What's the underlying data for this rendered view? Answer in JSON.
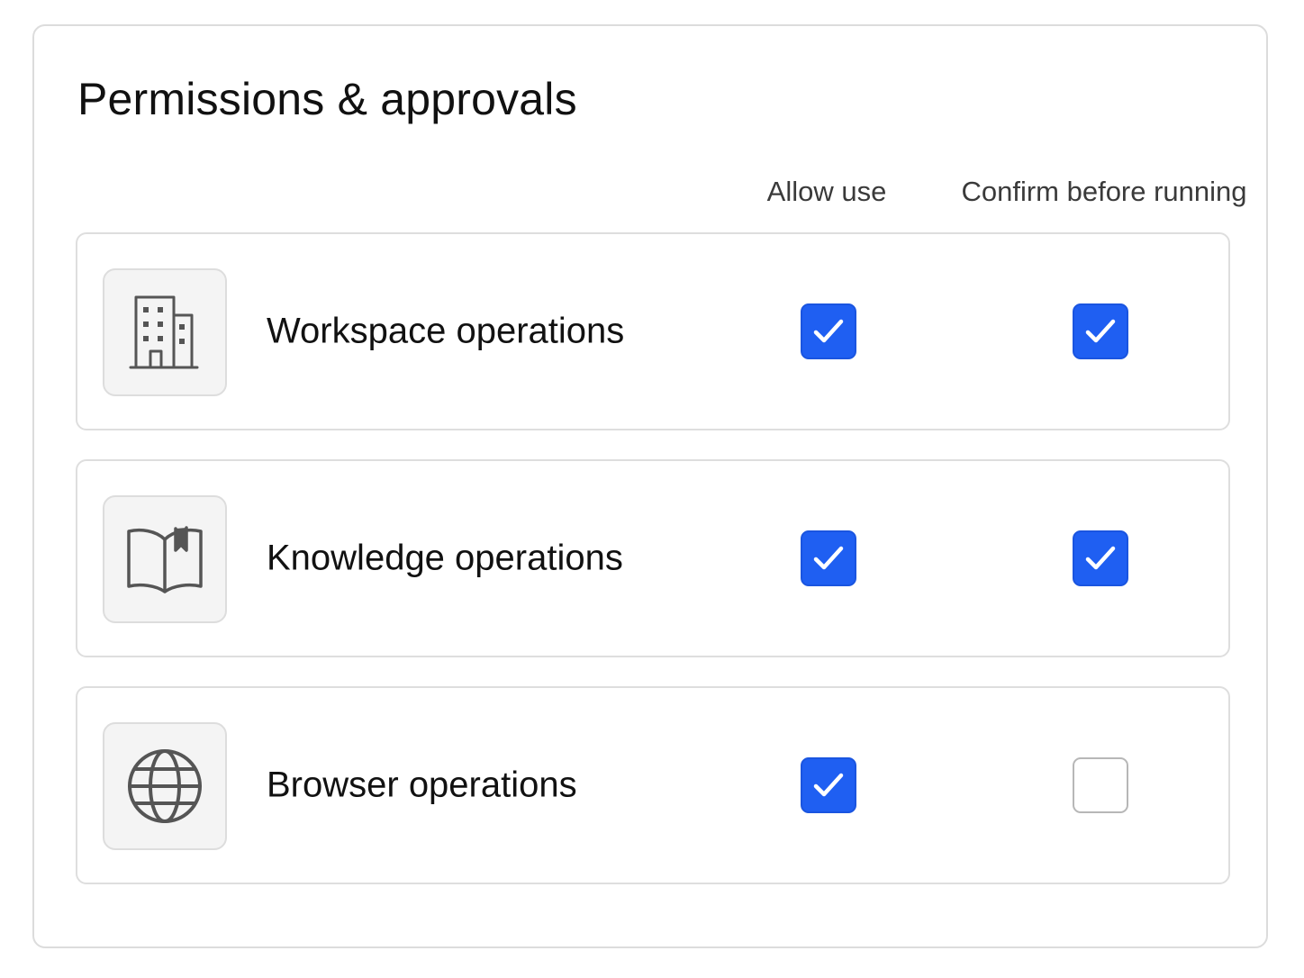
{
  "title": "Permissions & approvals",
  "columns": {
    "allow": "Allow use",
    "confirm": "Confirm before running"
  },
  "rows": [
    {
      "label": "Workspace operations",
      "icon": "building-icon",
      "allow": true,
      "confirm": true
    },
    {
      "label": "Knowledge operations",
      "icon": "book-icon",
      "allow": true,
      "confirm": true
    },
    {
      "label": "Browser operations",
      "icon": "globe-icon",
      "allow": true,
      "confirm": false
    }
  ],
  "colors": {
    "accent": "#1f5ff2",
    "border": "#dedede",
    "icon_bg": "#f4f4f4",
    "icon_stroke": "#555555"
  }
}
